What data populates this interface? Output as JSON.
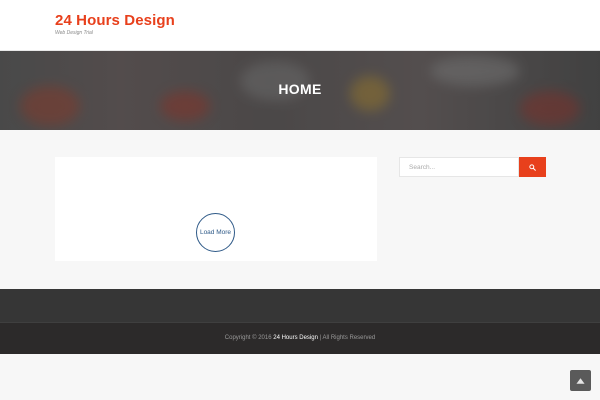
{
  "header": {
    "site_title": "24 Hours Design",
    "tagline": "Web Design Trial"
  },
  "banner": {
    "title": "HOME"
  },
  "main": {
    "load_more_label": "Load More"
  },
  "sidebar": {
    "search": {
      "placeholder": "Search...",
      "value": "",
      "button_icon": "search-icon"
    }
  },
  "footer": {
    "copyright_prefix": "Copyright © 2016",
    "brand": "24 Hours Design",
    "copyright_suffix": "| All Rights Reserved"
  },
  "back_to_top": {
    "icon": "arrow-up-icon"
  },
  "colors": {
    "accent": "#e8401c",
    "load_more": "#2f5a88",
    "footer_widgets": "#363636",
    "footer_bottom": "#2c2a2a",
    "page_background": "#f7f7f7"
  }
}
